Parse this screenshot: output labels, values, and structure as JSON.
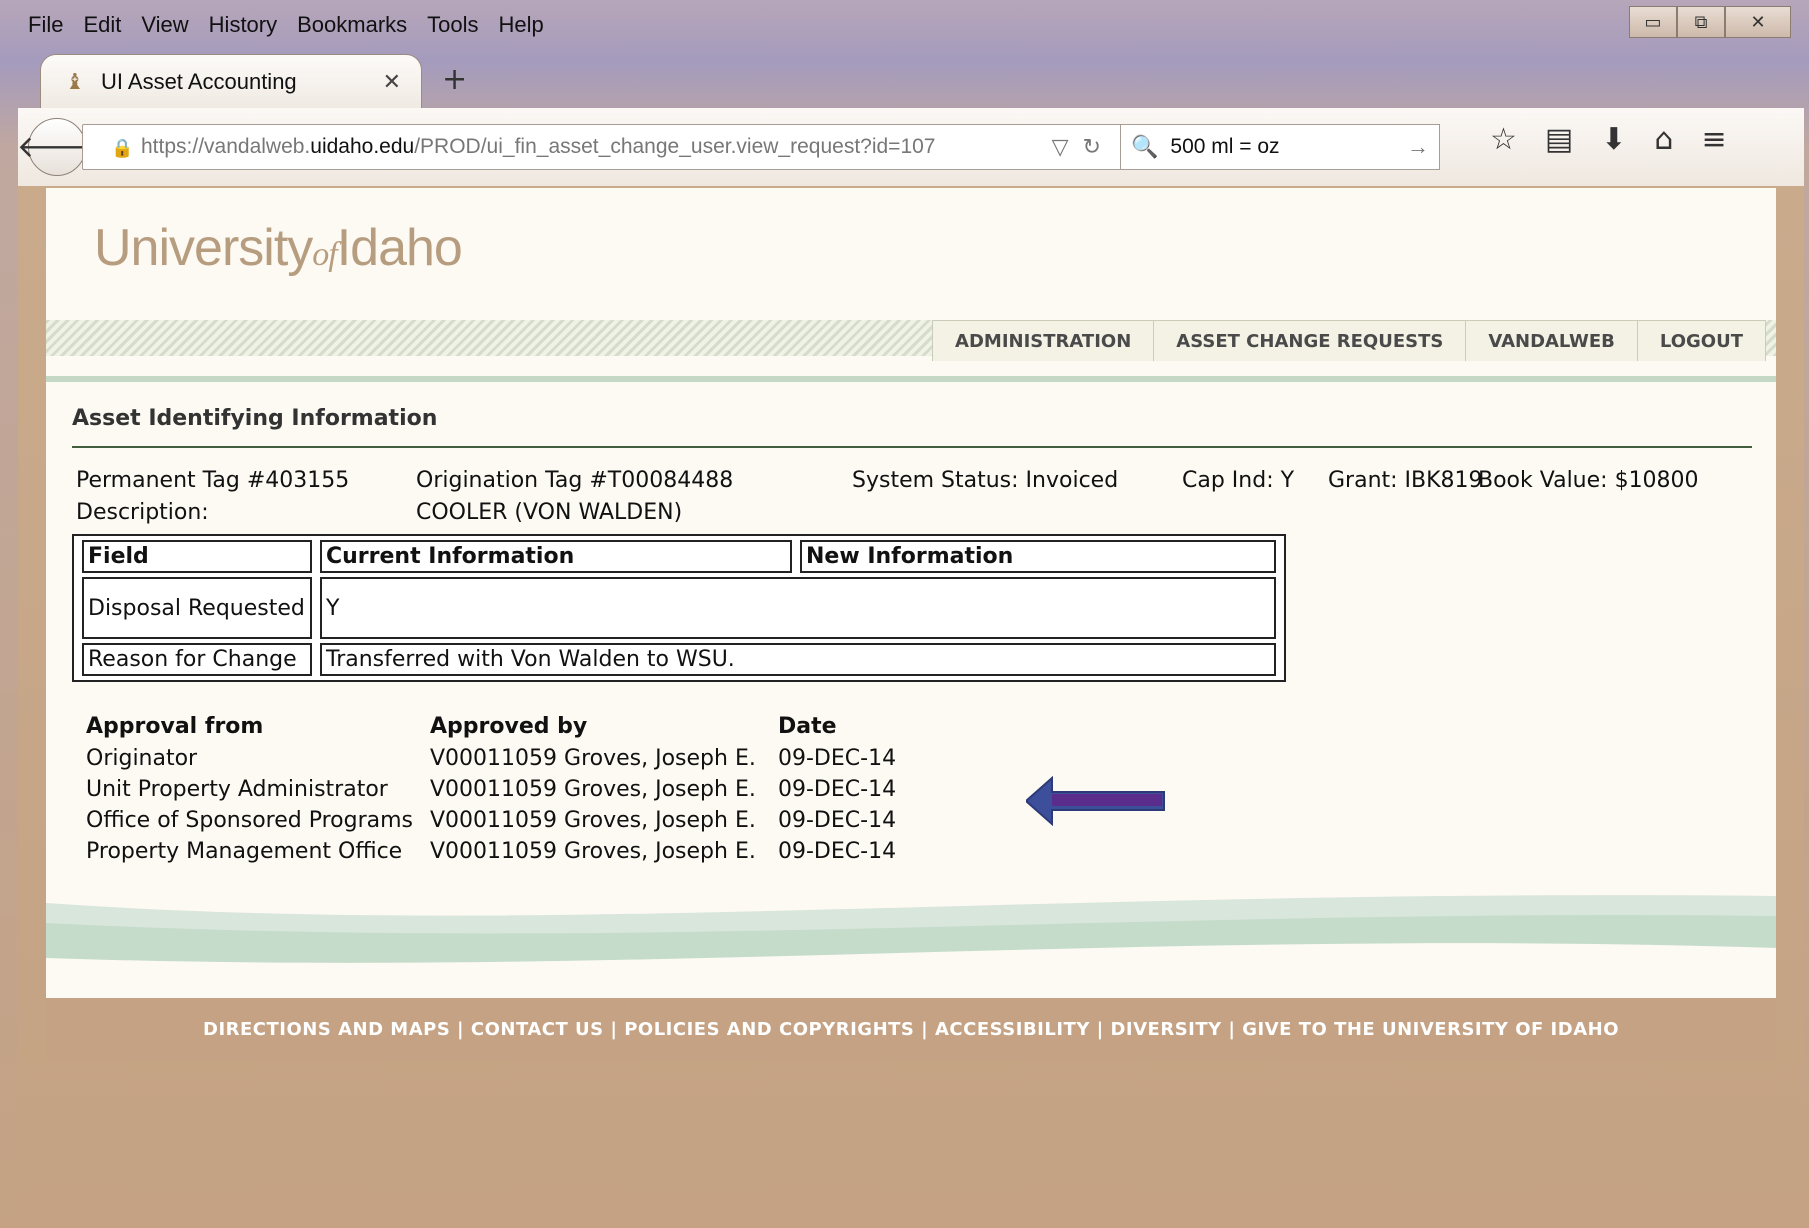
{
  "menu": [
    {
      "label": "File"
    },
    {
      "label": "Edit"
    },
    {
      "label": "View"
    },
    {
      "label": "History"
    },
    {
      "label": "Bookmarks"
    },
    {
      "label": "Tools"
    },
    {
      "label": "Help"
    }
  ],
  "window_controls": {
    "minimize": "▭",
    "restore": "⧉",
    "close": "✕"
  },
  "tab": {
    "title": "UI Asset Accounting",
    "close": "✕",
    "new": "+"
  },
  "url": {
    "prefix": "https://vandalweb.",
    "domain": "uidaho.edu",
    "path": "/PROD/ui_fin_asset_change_user.view_request?id=107"
  },
  "search": {
    "value": "500 ml = oz"
  },
  "page": {
    "logo_main1": "University",
    "logo_of": "of",
    "logo_main2": "Idaho",
    "nav": [
      "ADMINISTRATION",
      "ASSET CHANGE REQUESTS",
      "VANDALWEB",
      "LOGOUT"
    ],
    "section_title": "Asset Identifying Information",
    "info": {
      "permanent_tag": "Permanent Tag #403155",
      "origination_tag": "Origination Tag #T00084488",
      "system_status": "System Status: Invoiced",
      "cap_ind": "Cap Ind: Y",
      "grant": "Grant: IBK819",
      "book_value": "Book Value: $10800",
      "description_label": "Description:",
      "description_value": "COOLER (VON WALDEN)"
    },
    "changes": {
      "headers": [
        "Field",
        "Current Information",
        "New Information"
      ],
      "rows": [
        {
          "field": "Disposal Requested",
          "current": "Y",
          "new": ""
        },
        {
          "field": "Reason for Change",
          "value": "Transferred with Von Walden to WSU."
        }
      ]
    },
    "approvals": {
      "headers": [
        "Approval from",
        "Approved by",
        "Date"
      ],
      "rows": [
        {
          "from": "Originator",
          "by": "V00011059 Groves, Joseph E.",
          "date": "09-DEC-14"
        },
        {
          "from": "Unit Property Administrator",
          "by": "V00011059 Groves, Joseph E.",
          "date": "09-DEC-14"
        },
        {
          "from": "Office of Sponsored Programs",
          "by": "V00011059 Groves, Joseph E.",
          "date": "09-DEC-14"
        },
        {
          "from": "Property Management Office",
          "by": "V00011059 Groves, Joseph E.",
          "date": "09-DEC-14"
        }
      ]
    },
    "footer": "DIRECTIONS AND MAPS | CONTACT US | POLICIES AND COPYRIGHTS | ACCESSIBILITY | DIVERSITY | GIVE TO THE UNIVERSITY OF IDAHO"
  },
  "colors": {
    "accent": "#c4a283",
    "logo": "#b79d7f",
    "arrow": "#5a2d8c"
  }
}
